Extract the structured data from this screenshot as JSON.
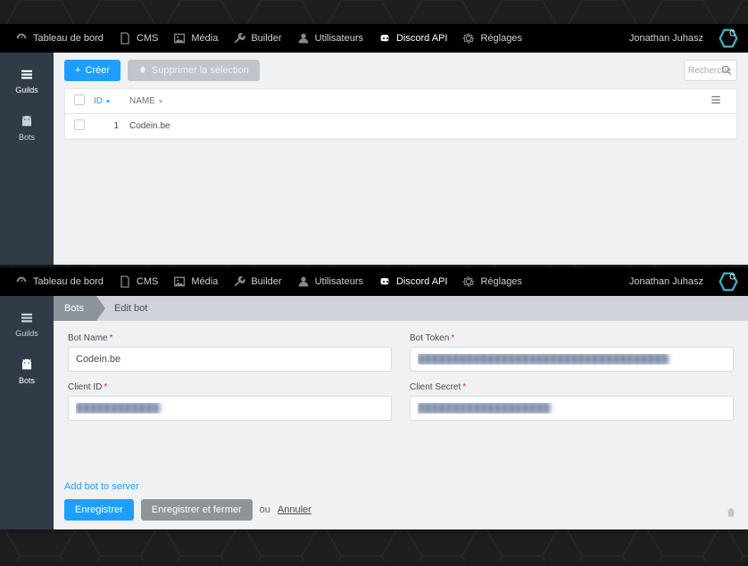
{
  "nav": {
    "items": [
      {
        "label": "Tableau de bord",
        "icon": "gauge"
      },
      {
        "label": "CMS",
        "icon": "page"
      },
      {
        "label": "Média",
        "icon": "image"
      },
      {
        "label": "Builder",
        "icon": "wrench"
      },
      {
        "label": "Utilisateurs",
        "icon": "user"
      },
      {
        "label": "Discord API",
        "icon": "discord",
        "active": true
      },
      {
        "label": "Réglages",
        "icon": "gear"
      }
    ],
    "user": "Jonathan Juhasz"
  },
  "screen1": {
    "sidebar": [
      {
        "label": "Guilds",
        "icon": "stack",
        "active": true
      },
      {
        "label": "Bots",
        "icon": "android"
      }
    ],
    "toolbar": {
      "create": "Créer",
      "delete": "Supprimer la sélection",
      "search": "Recherche"
    },
    "table": {
      "cols": {
        "id": "ID",
        "name": "NAME"
      },
      "rows": [
        {
          "id": "1",
          "name": "Codein.be"
        }
      ]
    }
  },
  "screen2": {
    "sidebar": [
      {
        "label": "Guilds",
        "icon": "stack"
      },
      {
        "label": "Bots",
        "icon": "android",
        "active": true
      }
    ],
    "breadcrumb": {
      "first": "Bots",
      "second": "Edit bot"
    },
    "fields": {
      "botname": {
        "label": "Bot Name",
        "value": "Codein.be"
      },
      "bottoken": {
        "label": "Bot Token",
        "value": "████████████████████████████████████"
      },
      "clientid": {
        "label": "Client ID",
        "value": "████████████"
      },
      "clientsecret": {
        "label": "Client Secret",
        "value": "███████████████████"
      }
    },
    "footer": {
      "addlink": "Add bot to server",
      "save": "Enregistrer",
      "saveclose": "Enregistrer et fermer",
      "or": "ou",
      "cancel": "Annuler"
    }
  }
}
